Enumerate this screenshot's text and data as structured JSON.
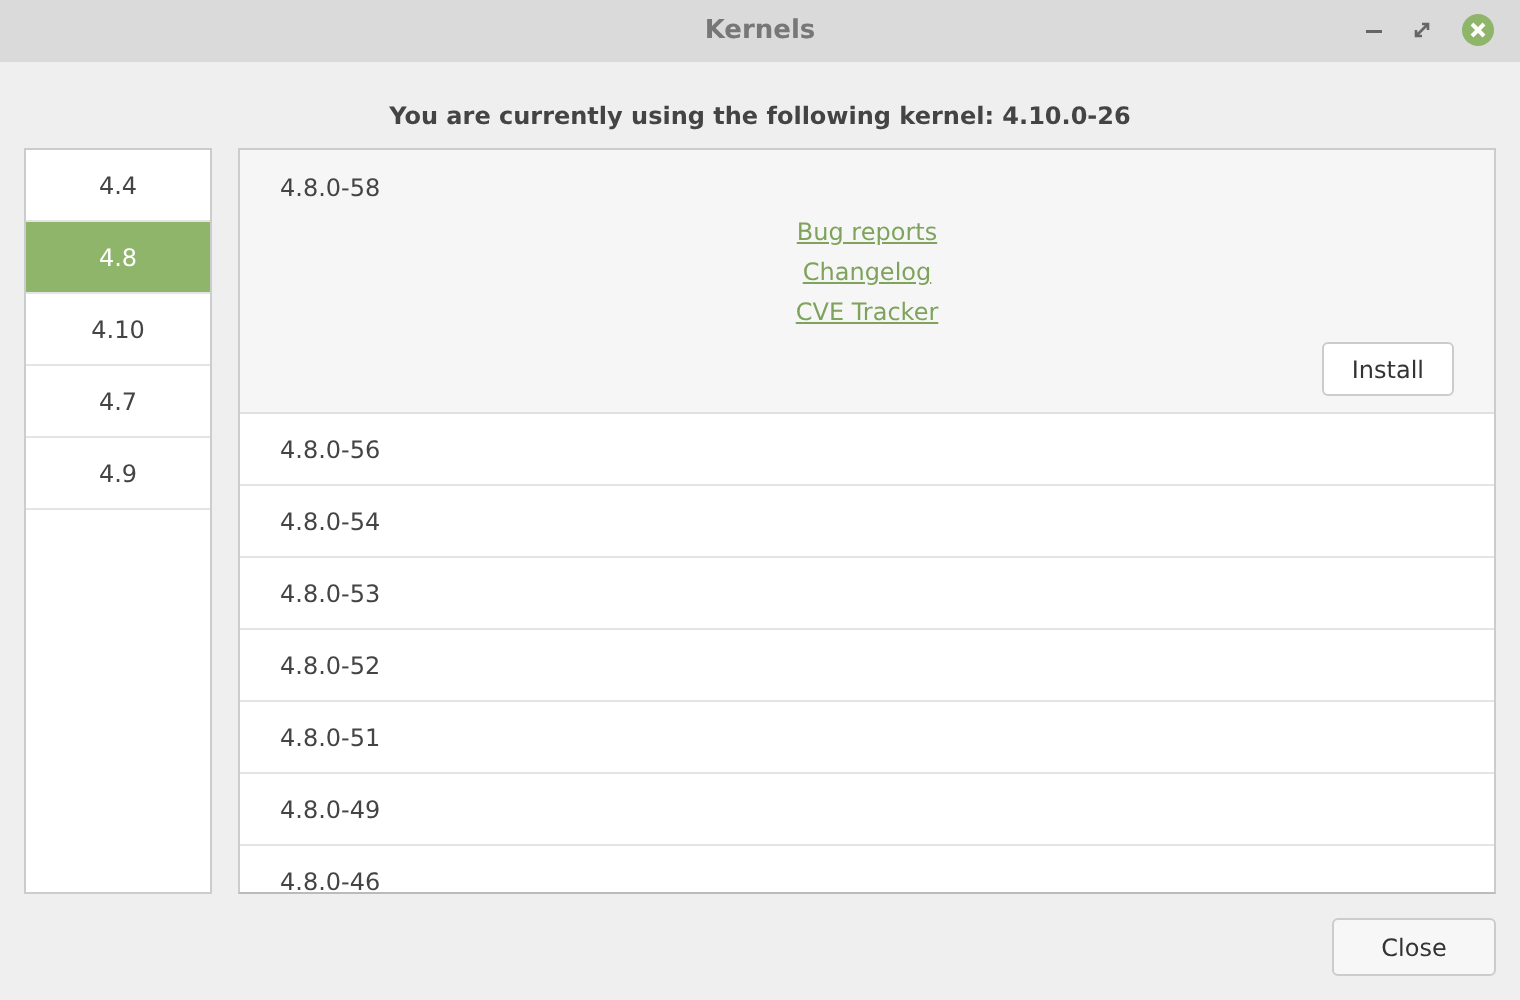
{
  "window": {
    "title": "Kernels"
  },
  "header": "You are currently using the following kernel: 4.10.0-26",
  "series": [
    {
      "label": "4.4",
      "selected": false
    },
    {
      "label": "4.8",
      "selected": true
    },
    {
      "label": "4.10",
      "selected": false
    },
    {
      "label": "4.7",
      "selected": false
    },
    {
      "label": "4.9",
      "selected": false
    }
  ],
  "kernels": [
    {
      "version": "4.8.0-58",
      "expanded": true,
      "links": [
        "Bug reports",
        "Changelog",
        "CVE Tracker"
      ],
      "button": "Install"
    },
    {
      "version": "4.8.0-56",
      "expanded": false
    },
    {
      "version": "4.8.0-54",
      "expanded": false
    },
    {
      "version": "4.8.0-53",
      "expanded": false
    },
    {
      "version": "4.8.0-52",
      "expanded": false
    },
    {
      "version": "4.8.0-51",
      "expanded": false
    },
    {
      "version": "4.8.0-49",
      "expanded": false
    },
    {
      "version": "4.8.0-46",
      "expanded": false
    }
  ],
  "buttons": [
    "Close"
  ]
}
